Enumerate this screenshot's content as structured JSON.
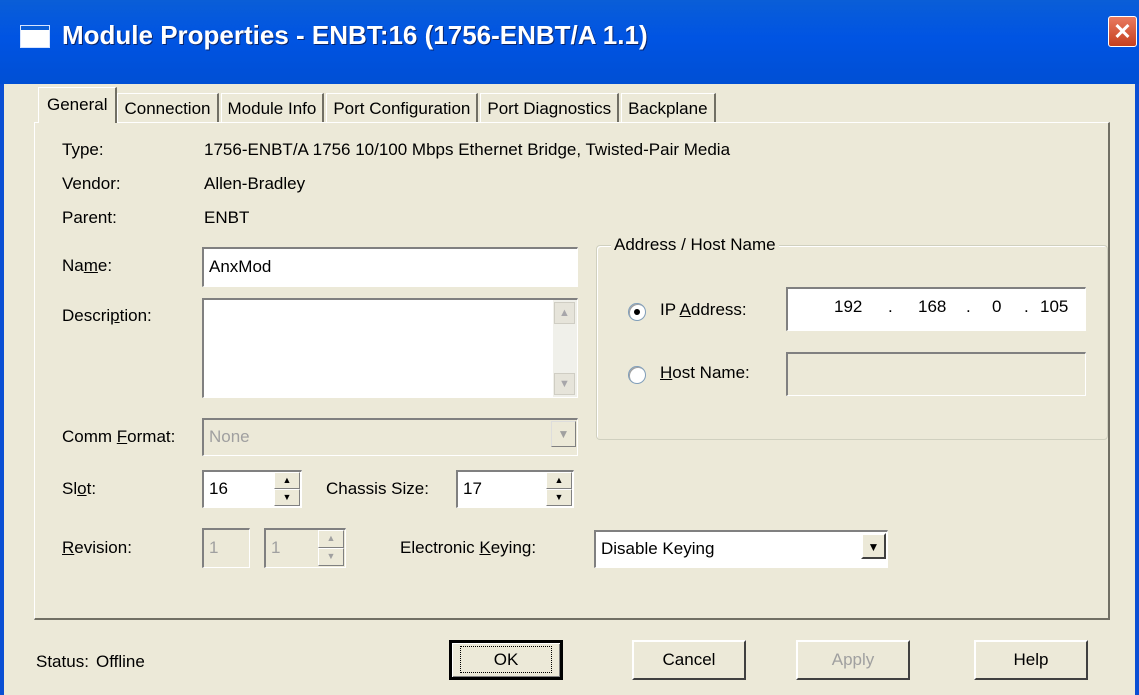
{
  "window": {
    "title": "Module Properties  - ENBT:16 (1756-ENBT/A 1.1)",
    "close_glyph": "✕"
  },
  "tabs": [
    "General",
    "Connection",
    "Module Info",
    "Port Configuration",
    "Port Diagnostics",
    "Backplane"
  ],
  "general": {
    "type_label": "Type:",
    "type_value": "1756-ENBT/A 1756 10/100 Mbps Ethernet Bridge, Twisted-Pair Media",
    "vendor_label": "Vendor:",
    "vendor_value": "Allen-Bradley",
    "parent_label": "Parent:",
    "parent_value": "ENBT",
    "name_label_pre": "Na",
    "name_label_u": "m",
    "name_label_post": "e:",
    "name_value": "AnxMod",
    "description_label_pre": "Descri",
    "description_label_u": "p",
    "description_label_post": "tion:",
    "description_value": "",
    "comm_format_label_pre": "Comm ",
    "comm_format_label_u": "F",
    "comm_format_label_post": "ormat:",
    "comm_format_value": "None",
    "slot_label_pre": "Sl",
    "slot_label_u": "o",
    "slot_label_post": "t:",
    "slot_value": "16",
    "chassis_size_label": "Chassis Size:",
    "chassis_size_value": "17",
    "revision_label_u": "R",
    "revision_label_post": "evision:",
    "revision_major": "1",
    "revision_minor": "1",
    "keying_label_pre": "Electronic ",
    "keying_label_u": "K",
    "keying_label_post": "eying:",
    "keying_value": "Disable Keying"
  },
  "address": {
    "group_label": "Address / Host Name",
    "ip_label_pre": "IP ",
    "ip_label_u": "A",
    "ip_label_post": "ddress:",
    "ip_octets": [
      "192",
      "168",
      "0",
      "105"
    ],
    "ip_dot": ".",
    "host_label_u": "H",
    "host_label_post": "ost Name:",
    "host_value": "",
    "selected": "ip"
  },
  "status": {
    "label": "Status:",
    "value": "Offline"
  },
  "buttons": {
    "ok": "OK",
    "cancel": "Cancel",
    "apply": "Apply",
    "help": "Help"
  }
}
